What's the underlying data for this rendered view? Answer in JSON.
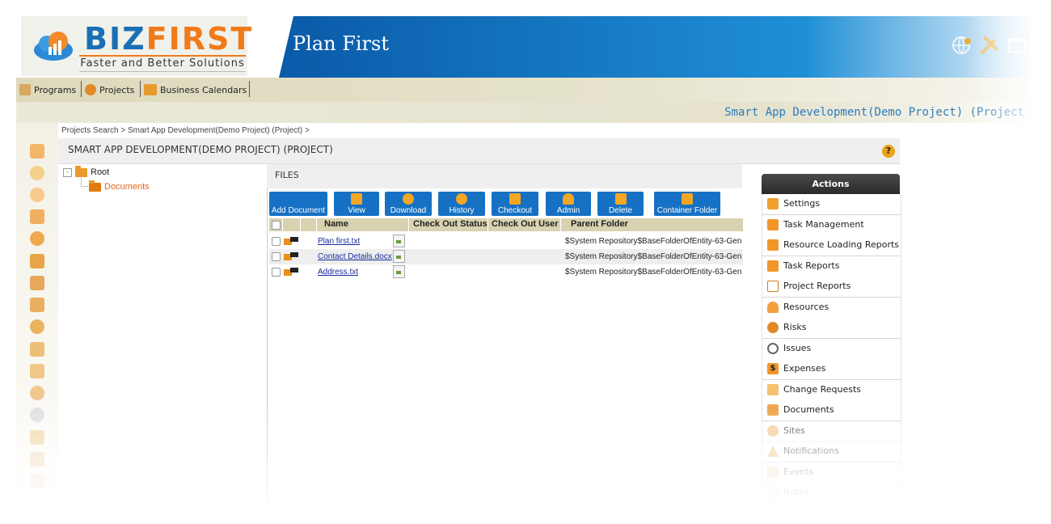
{
  "header": {
    "logo_biz": "BIZ",
    "logo_first": "FIRST",
    "logo_tagline": "Faster and Better Solutions",
    "app_title": "Plan First",
    "icons": [
      "globe-user-icon",
      "tools-icon",
      "window-icon"
    ]
  },
  "menu": {
    "items": [
      {
        "label": "Programs",
        "icon": "programs-icon"
      },
      {
        "label": "Projects",
        "icon": "projects-icon"
      },
      {
        "label": "Business Calendars",
        "icon": "calendar-icon"
      }
    ]
  },
  "project_bar": {
    "title": "Smart App Development(Demo Project) (Project"
  },
  "breadcrumb": {
    "text": "Projects Search > Smart App Development(Demo Project) (Project) >"
  },
  "page": {
    "title": "SMART APP DEVELOPMENT(DEMO PROJECT) (PROJECT)",
    "help": "?"
  },
  "tree": {
    "root": "Root",
    "child": "Documents"
  },
  "files": {
    "title": "FILES",
    "toolbar": [
      "Add Document",
      "View",
      "Download",
      "History",
      "Checkout",
      "Admin",
      "Delete",
      "Container Folder"
    ],
    "columns": [
      "Name",
      "Check Out Status",
      "Check Out User",
      "Parent Folder"
    ],
    "rows": [
      {
        "name": "Plan first.txt",
        "parent": "$System Repository$BaseFolderOfEntity-63-Gen"
      },
      {
        "name": "Contact Details.docx",
        "parent": "$System Repository$BaseFolderOfEntity-63-Gen"
      },
      {
        "name": "Address.txt",
        "parent": "$System Repository$BaseFolderOfEntity-63-Gen"
      }
    ]
  },
  "actions": {
    "title": "Actions",
    "items": [
      {
        "label": "Settings",
        "icon": "settings-icon"
      },
      {
        "label": "Task Management",
        "icon": "task-management-icon"
      },
      {
        "label": "Resource Loading Reports",
        "icon": "resource-loading-icon"
      },
      {
        "label": "Task Reports",
        "icon": "task-reports-icon"
      },
      {
        "label": "Project Reports",
        "icon": "project-reports-icon"
      },
      {
        "label": "Resources",
        "icon": "resources-icon"
      },
      {
        "label": "Risks",
        "icon": "risks-icon"
      },
      {
        "label": "Issues",
        "icon": "issues-icon"
      },
      {
        "label": "Expenses",
        "icon": "expenses-icon"
      },
      {
        "label": "Change Requests",
        "icon": "change-requests-icon"
      },
      {
        "label": "Documents",
        "icon": "documents-icon"
      },
      {
        "label": "Sites",
        "icon": "sites-icon"
      },
      {
        "label": "Notifications",
        "icon": "notifications-icon"
      },
      {
        "label": "Events",
        "icon": "events-icon"
      },
      {
        "label": "Notes",
        "icon": "notes-icon"
      }
    ]
  },
  "colors": {
    "brand_blue": "#1671c4",
    "brand_orange": "#f07a1a",
    "link": "#1a2a9a"
  }
}
